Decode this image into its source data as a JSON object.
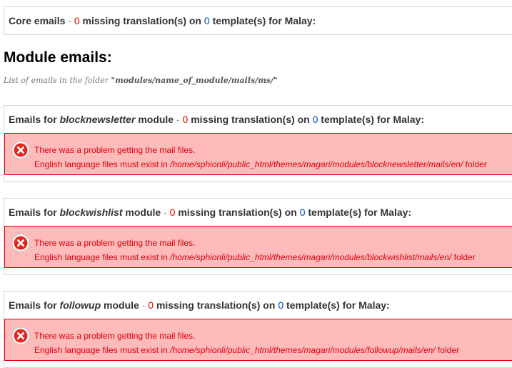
{
  "core": {
    "label": "Core emails",
    "separator": "-",
    "missing_count": "0",
    "missing_text": "missing translation(s) on",
    "template_count": "0",
    "template_text": "template(s) for Malay:"
  },
  "module_section": {
    "title": "Module emails:",
    "hint_prefix": "List of emails in the folder",
    "hint_path": "\"modules/name_of_module/mails/ms/\""
  },
  "modules": [
    {
      "prefix": "Emails for",
      "name": "blocknewsletter",
      "suffix": "module",
      "separator": "-",
      "missing_count": "0",
      "missing_text": "missing translation(s) on",
      "template_count": "0",
      "template_text": "template(s) for Malay:",
      "error_title": "There was a problem getting the mail files.",
      "error_prefix": "English language files must exist in",
      "error_path": "/home/sphionli/public_html/themes/magari/modules/blocknewsletter/mails/en/",
      "error_suffix": "folder"
    },
    {
      "prefix": "Emails for",
      "name": "blockwishlist",
      "suffix": "module",
      "separator": "-",
      "missing_count": "0",
      "missing_text": "missing translation(s) on",
      "template_count": "0",
      "template_text": "template(s) for Malay:",
      "error_title": "There was a problem getting the mail files.",
      "error_prefix": "English language files must exist in",
      "error_path": "/home/sphionli/public_html/themes/magari/modules/blockwishlist/mails/en/",
      "error_suffix": "folder"
    },
    {
      "prefix": "Emails for",
      "name": "followup",
      "suffix": "module",
      "separator": "-",
      "missing_count": "0",
      "missing_text": "missing translation(s) on",
      "template_count": "0",
      "template_text": "template(s) for Malay:",
      "error_title": "There was a problem getting the mail files.",
      "error_prefix": "English language files must exist in",
      "error_path": "/home/sphionli/public_html/themes/magari/modules/followup/mails/en/",
      "error_suffix": "folder"
    }
  ],
  "icons": {
    "error": "error-circle-x-icon"
  },
  "colors": {
    "missing": "#e30000",
    "template": "#0044cc",
    "error_bg": "#ffbaba",
    "error_text": "#d8000c"
  }
}
